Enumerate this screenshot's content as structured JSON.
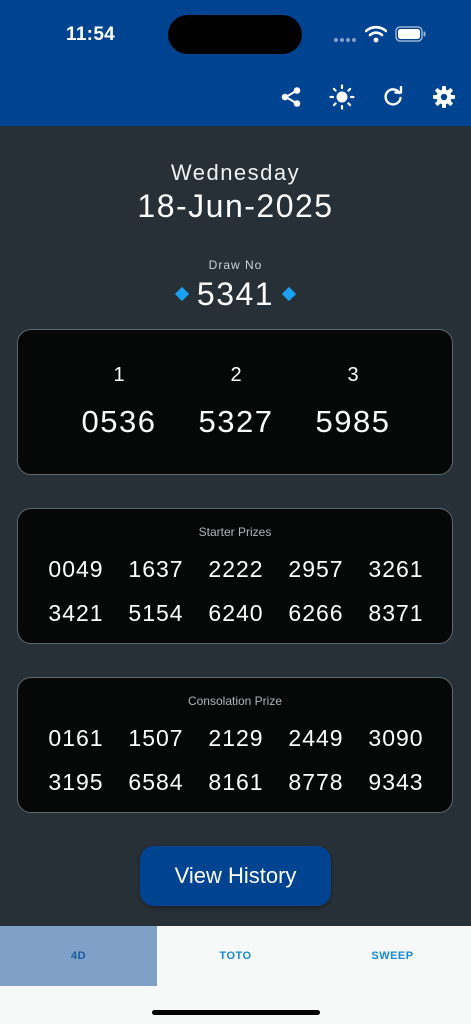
{
  "status_bar": {
    "time": "11:54"
  },
  "toolbar": {
    "icons": [
      "share-icon",
      "brightness-icon",
      "refresh-icon",
      "gear-icon"
    ]
  },
  "draw": {
    "weekday": "Wednesday",
    "date": "18-Jun-2025",
    "draw_no_label": "Draw No",
    "draw_no": "5341"
  },
  "top_prizes": {
    "ranks": [
      "1",
      "2",
      "3"
    ],
    "numbers": [
      "0536",
      "5327",
      "5985"
    ]
  },
  "starter": {
    "title": "Starter Prizes",
    "row1": [
      "0049",
      "1637",
      "2222",
      "2957",
      "3261"
    ],
    "row2": [
      "3421",
      "5154",
      "6240",
      "6266",
      "8371"
    ]
  },
  "consolation": {
    "title": "Consolation Prize",
    "row1": [
      "0161",
      "1507",
      "2129",
      "2449",
      "3090"
    ],
    "row2": [
      "3195",
      "6584",
      "8161",
      "8778",
      "9343"
    ]
  },
  "history_button": {
    "label": "View History"
  },
  "tabs": [
    {
      "label": "4D",
      "active": true
    },
    {
      "label": "TOTO",
      "active": false
    },
    {
      "label": "SWEEP",
      "active": false
    }
  ],
  "colors": {
    "header": "#004390",
    "background": "#273036",
    "card": "#060808",
    "accent": "#1aa2f0",
    "tab_active": "#7fa1c7"
  }
}
